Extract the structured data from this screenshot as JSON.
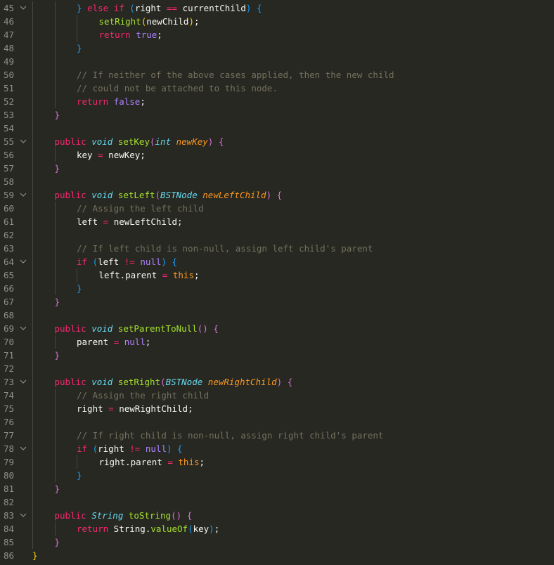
{
  "editor": {
    "lines": [
      {
        "n": "45",
        "fold": true,
        "indent": 2,
        "tokens": [
          [
            "b3",
            "}"
          ],
          [
            "p",
            " "
          ],
          [
            "kw",
            "else"
          ],
          [
            "p",
            " "
          ],
          [
            "kw",
            "if"
          ],
          [
            "p",
            " "
          ],
          [
            "b3",
            "("
          ],
          [
            "p",
            "right "
          ],
          [
            "op",
            "=="
          ],
          [
            "p",
            " currentChild"
          ],
          [
            "b3",
            ")"
          ],
          [
            "p",
            " "
          ],
          [
            "b3",
            "{"
          ]
        ]
      },
      {
        "n": "46",
        "fold": false,
        "indent": 3,
        "tokens": [
          [
            "fn",
            "setRight"
          ],
          [
            "b1",
            "("
          ],
          [
            "p",
            "newChild"
          ],
          [
            "b1",
            ")"
          ],
          [
            "p",
            ";"
          ]
        ]
      },
      {
        "n": "47",
        "fold": false,
        "indent": 3,
        "tokens": [
          [
            "kw",
            "return"
          ],
          [
            "p",
            " "
          ],
          [
            "lit",
            "true"
          ],
          [
            "p",
            ";"
          ]
        ]
      },
      {
        "n": "48",
        "fold": false,
        "indent": 2,
        "tokens": [
          [
            "b3",
            "}"
          ]
        ]
      },
      {
        "n": "49",
        "fold": false,
        "indent": 0,
        "tokens": []
      },
      {
        "n": "50",
        "fold": false,
        "indent": 2,
        "tokens": [
          [
            "cm",
            "// If neither of the above cases applied, then the new child"
          ]
        ]
      },
      {
        "n": "51",
        "fold": false,
        "indent": 2,
        "tokens": [
          [
            "cm",
            "// could not be attached to this node."
          ]
        ]
      },
      {
        "n": "52",
        "fold": false,
        "indent": 2,
        "tokens": [
          [
            "kw",
            "return"
          ],
          [
            "p",
            " "
          ],
          [
            "lit",
            "false"
          ],
          [
            "p",
            ";"
          ]
        ]
      },
      {
        "n": "53",
        "fold": false,
        "indent": 1,
        "tokens": [
          [
            "b2",
            "}"
          ]
        ]
      },
      {
        "n": "54",
        "fold": false,
        "indent": 0,
        "tokens": []
      },
      {
        "n": "55",
        "fold": true,
        "indent": 1,
        "tokens": [
          [
            "kw",
            "public"
          ],
          [
            "p",
            " "
          ],
          [
            "ty",
            "void"
          ],
          [
            "p",
            " "
          ],
          [
            "fn",
            "setKey"
          ],
          [
            "b2",
            "("
          ],
          [
            "ty",
            "int"
          ],
          [
            "p",
            " "
          ],
          [
            "pa",
            "newKey"
          ],
          [
            "b2",
            ")"
          ],
          [
            "p",
            " "
          ],
          [
            "b2",
            "{"
          ]
        ]
      },
      {
        "n": "56",
        "fold": false,
        "indent": 2,
        "tokens": [
          [
            "p",
            "key "
          ],
          [
            "op",
            "="
          ],
          [
            "p",
            " newKey;"
          ]
        ]
      },
      {
        "n": "57",
        "fold": false,
        "indent": 1,
        "tokens": [
          [
            "b2",
            "}"
          ]
        ]
      },
      {
        "n": "58",
        "fold": false,
        "indent": 0,
        "tokens": []
      },
      {
        "n": "59",
        "fold": true,
        "indent": 1,
        "tokens": [
          [
            "kw",
            "public"
          ],
          [
            "p",
            " "
          ],
          [
            "ty",
            "void"
          ],
          [
            "p",
            " "
          ],
          [
            "fn",
            "setLeft"
          ],
          [
            "b2",
            "("
          ],
          [
            "ty",
            "BSTNode"
          ],
          [
            "p",
            " "
          ],
          [
            "pa",
            "newLeftChild"
          ],
          [
            "b2",
            ")"
          ],
          [
            "p",
            " "
          ],
          [
            "b2",
            "{"
          ]
        ]
      },
      {
        "n": "60",
        "fold": false,
        "indent": 2,
        "tokens": [
          [
            "cm",
            "// Assign the left child"
          ]
        ]
      },
      {
        "n": "61",
        "fold": false,
        "indent": 2,
        "tokens": [
          [
            "p",
            "left "
          ],
          [
            "op",
            "="
          ],
          [
            "p",
            " newLeftChild;"
          ]
        ]
      },
      {
        "n": "62",
        "fold": false,
        "indent": 0,
        "tokens": []
      },
      {
        "n": "63",
        "fold": false,
        "indent": 2,
        "tokens": [
          [
            "cm",
            "// If left child is non-null, assign left child's parent"
          ]
        ]
      },
      {
        "n": "64",
        "fold": true,
        "indent": 2,
        "tokens": [
          [
            "kw",
            "if"
          ],
          [
            "p",
            " "
          ],
          [
            "b3",
            "("
          ],
          [
            "p",
            "left "
          ],
          [
            "op",
            "!="
          ],
          [
            "p",
            " "
          ],
          [
            "lit",
            "null"
          ],
          [
            "b3",
            ")"
          ],
          [
            "p",
            " "
          ],
          [
            "b3",
            "{"
          ]
        ]
      },
      {
        "n": "65",
        "fold": false,
        "indent": 3,
        "tokens": [
          [
            "p",
            "left.parent "
          ],
          [
            "op",
            "="
          ],
          [
            "p",
            " "
          ],
          [
            "this",
            "this"
          ],
          [
            "p",
            ";"
          ]
        ]
      },
      {
        "n": "66",
        "fold": false,
        "indent": 2,
        "tokens": [
          [
            "b3",
            "}"
          ]
        ]
      },
      {
        "n": "67",
        "fold": false,
        "indent": 1,
        "tokens": [
          [
            "b2",
            "}"
          ]
        ]
      },
      {
        "n": "68",
        "fold": false,
        "indent": 0,
        "tokens": []
      },
      {
        "n": "69",
        "fold": true,
        "indent": 1,
        "tokens": [
          [
            "kw",
            "public"
          ],
          [
            "p",
            " "
          ],
          [
            "ty",
            "void"
          ],
          [
            "p",
            " "
          ],
          [
            "fn",
            "setParentToNull"
          ],
          [
            "b2",
            "()"
          ],
          [
            "p",
            " "
          ],
          [
            "b2",
            "{"
          ]
        ]
      },
      {
        "n": "70",
        "fold": false,
        "indent": 2,
        "tokens": [
          [
            "p",
            "parent "
          ],
          [
            "op",
            "="
          ],
          [
            "p",
            " "
          ],
          [
            "lit",
            "null"
          ],
          [
            "p",
            ";"
          ]
        ]
      },
      {
        "n": "71",
        "fold": false,
        "indent": 1,
        "tokens": [
          [
            "b2",
            "}"
          ]
        ]
      },
      {
        "n": "72",
        "fold": false,
        "indent": 0,
        "tokens": []
      },
      {
        "n": "73",
        "fold": true,
        "indent": 1,
        "tokens": [
          [
            "kw",
            "public"
          ],
          [
            "p",
            " "
          ],
          [
            "ty",
            "void"
          ],
          [
            "p",
            " "
          ],
          [
            "fn",
            "setRight"
          ],
          [
            "b2",
            "("
          ],
          [
            "ty",
            "BSTNode"
          ],
          [
            "p",
            " "
          ],
          [
            "pa",
            "newRightChild"
          ],
          [
            "b2",
            ")"
          ],
          [
            "p",
            " "
          ],
          [
            "b2",
            "{"
          ]
        ]
      },
      {
        "n": "74",
        "fold": false,
        "indent": 2,
        "tokens": [
          [
            "cm",
            "// Assign the right child"
          ]
        ]
      },
      {
        "n": "75",
        "fold": false,
        "indent": 2,
        "tokens": [
          [
            "p",
            "right "
          ],
          [
            "op",
            "="
          ],
          [
            "p",
            " newRightChild;"
          ]
        ]
      },
      {
        "n": "76",
        "fold": false,
        "indent": 0,
        "tokens": []
      },
      {
        "n": "77",
        "fold": false,
        "indent": 2,
        "tokens": [
          [
            "cm",
            "// If right child is non-null, assign right child's parent"
          ]
        ]
      },
      {
        "n": "78",
        "fold": true,
        "indent": 2,
        "tokens": [
          [
            "kw",
            "if"
          ],
          [
            "p",
            " "
          ],
          [
            "b3",
            "("
          ],
          [
            "p",
            "right "
          ],
          [
            "op",
            "!="
          ],
          [
            "p",
            " "
          ],
          [
            "lit",
            "null"
          ],
          [
            "b3",
            ")"
          ],
          [
            "p",
            " "
          ],
          [
            "b3",
            "{"
          ]
        ]
      },
      {
        "n": "79",
        "fold": false,
        "indent": 3,
        "tokens": [
          [
            "p",
            "right.parent "
          ],
          [
            "op",
            "="
          ],
          [
            "p",
            " "
          ],
          [
            "this",
            "this"
          ],
          [
            "p",
            ";"
          ]
        ]
      },
      {
        "n": "80",
        "fold": false,
        "indent": 2,
        "tokens": [
          [
            "b3",
            "}"
          ]
        ]
      },
      {
        "n": "81",
        "fold": false,
        "indent": 1,
        "tokens": [
          [
            "b2",
            "}"
          ]
        ]
      },
      {
        "n": "82",
        "fold": false,
        "indent": 0,
        "tokens": []
      },
      {
        "n": "83",
        "fold": true,
        "indent": 1,
        "tokens": [
          [
            "kw",
            "public"
          ],
          [
            "p",
            " "
          ],
          [
            "ty",
            "String"
          ],
          [
            "p",
            " "
          ],
          [
            "fn",
            "toString"
          ],
          [
            "b2",
            "()"
          ],
          [
            "p",
            " "
          ],
          [
            "b2",
            "{"
          ]
        ]
      },
      {
        "n": "84",
        "fold": false,
        "indent": 2,
        "tokens": [
          [
            "kw",
            "return"
          ],
          [
            "p",
            " String."
          ],
          [
            "fn",
            "valueOf"
          ],
          [
            "b3",
            "("
          ],
          [
            "p",
            "key"
          ],
          [
            "b3",
            ")"
          ],
          [
            "p",
            ";"
          ]
        ]
      },
      {
        "n": "85",
        "fold": false,
        "indent": 1,
        "tokens": [
          [
            "b2",
            "}"
          ]
        ]
      },
      {
        "n": "86",
        "fold": false,
        "indent": 0,
        "tokens": [
          [
            "b1",
            "}"
          ]
        ]
      }
    ]
  }
}
